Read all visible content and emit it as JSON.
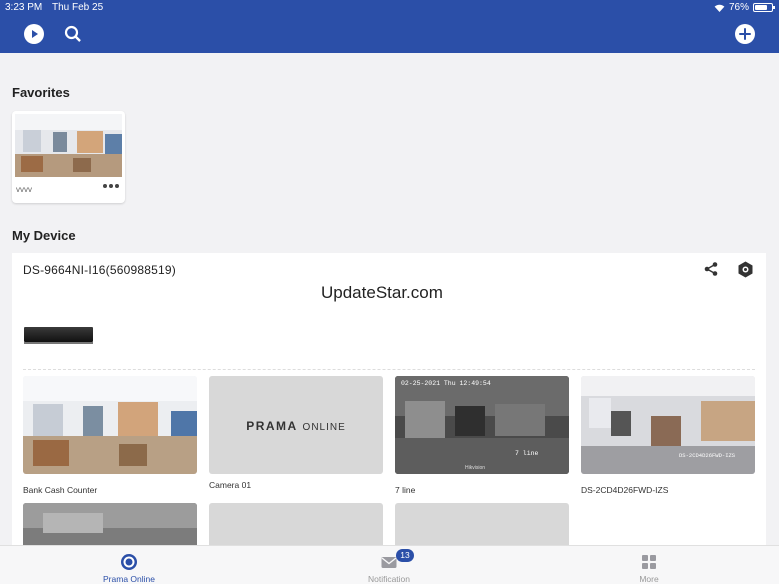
{
  "status_bar": {
    "time": "3:23 PM",
    "date": "Thu Feb 25",
    "battery": "76%"
  },
  "favorites": {
    "title": "Favorites",
    "items": [
      {
        "name": "vvvv"
      }
    ]
  },
  "my_device": {
    "title": "My Device",
    "device_name": "DS-9664NI-I16(560988519)",
    "watermark": "UpdateStar.com",
    "cameras": [
      {
        "label": "Bank Cash Counter"
      },
      {
        "label": "Camera 01",
        "placeholder_brand": "PRAMA",
        "placeholder_sub": "ONLINE"
      },
      {
        "label": "7 line",
        "overlay_time": "02-25-2021 Thu 12:49:54",
        "overlay_name": "7 line",
        "overlay_brand": "Hikvision"
      },
      {
        "label": "DS-2CD4D26FWD-IZS",
        "overlay_name": "DS-2CD4D26FWD-IZS"
      }
    ]
  },
  "bottom_nav": {
    "items": [
      {
        "label": "Prama Online"
      },
      {
        "label": "Notification",
        "badge": "13"
      },
      {
        "label": "More"
      }
    ]
  },
  "colors": {
    "primary": "#2b4fa8",
    "background": "#f2f2f4"
  }
}
